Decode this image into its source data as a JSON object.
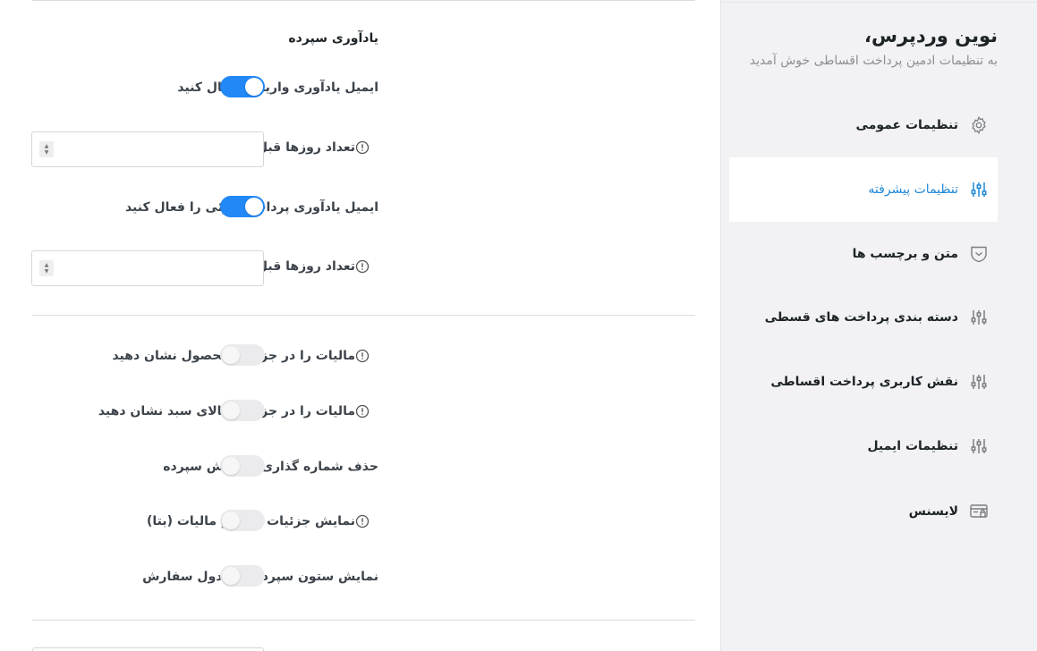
{
  "sidebar": {
    "brand_title": "نوین وردپرس،",
    "brand_subtitle": "به تنظیمات ادمین پرداخت اقساطی خوش آمدید",
    "items": [
      {
        "label": "تنظیمات عمومی",
        "icon": "gear-icon"
      },
      {
        "label": "تنظیمات پیشرفته",
        "icon": "sliders-icon",
        "active": true
      },
      {
        "label": "متن و برچسب ها",
        "icon": "shield-icon"
      },
      {
        "label": "دسته بندی پرداخت های قسطی",
        "icon": "sliders-icon"
      },
      {
        "label": "نقش کاربری پرداخت اقساطی",
        "icon": "sliders-icon"
      },
      {
        "label": "تنظیمات ایمیل",
        "icon": "sliders-icon"
      },
      {
        "label": "لایسنس",
        "icon": "license-icon"
      }
    ]
  },
  "main": {
    "section_title": "یادآوری سپرده",
    "settings": [
      {
        "label": "ایمیل یادآوری واریز را فعال کنید",
        "type": "toggle",
        "on": true
      },
      {
        "label": "تعداد روزها قبل از سر رسید برای یادآوری سپرده",
        "type": "number",
        "value": "",
        "info": true
      },
      {
        "label": "ایمیل یادآوری پرداخت جزئی را فعال کنید",
        "type": "toggle",
        "on": true
      },
      {
        "label": "تعداد روزها قبل از یادآوری",
        "type": "number",
        "value": "",
        "info": true
      },
      {
        "label": "مالیات را در جزئیات محصول نشان دهید",
        "type": "toggle",
        "on": false,
        "info": true
      },
      {
        "label": "مالیات را در جزئیات کالای سبد نشان دهید",
        "type": "toggle",
        "on": false,
        "info": true
      },
      {
        "label": "حذف شماره گذاری سفارش سپرده",
        "type": "toggle",
        "on": false
      },
      {
        "label": "نمایش جزئیات تقسیم مالیات (بتا)",
        "type": "toggle",
        "on": false,
        "info": true
      },
      {
        "label": "نمایش ستون سپرده در جدول سفارش",
        "type": "toggle",
        "on": false
      }
    ]
  },
  "colors": {
    "accent": "#2188f5",
    "active_nav_text": "#2188d6",
    "sidebar_bg": "#f2f2f4",
    "toggle_off": "#ebebed"
  }
}
